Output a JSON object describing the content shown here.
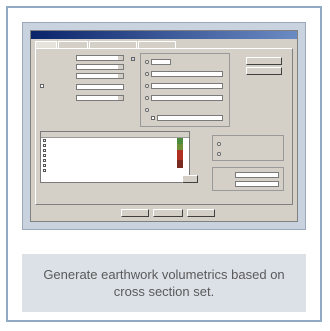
{
  "caption": {
    "text": "Generate earthwork volumetrics based on cross section set."
  },
  "dialog": {
    "title": "",
    "tabs": [
      "",
      "",
      "",
      ""
    ],
    "buttons": {
      "ok": "",
      "apply": "",
      "cancel": ""
    }
  },
  "colors": {
    "frame_border": "#8fa9c7",
    "caption_bg": "#dce1e8",
    "caption_text": "#5a5a5a",
    "titlebar": "#0a246a"
  }
}
